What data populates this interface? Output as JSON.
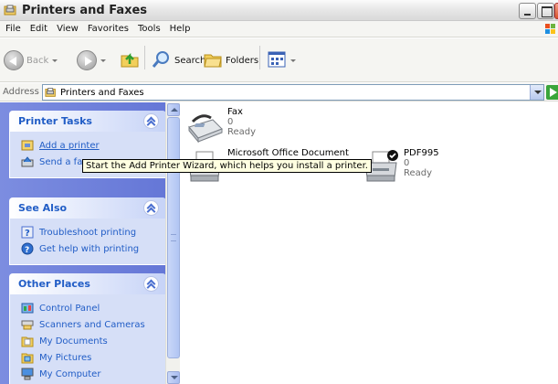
{
  "window": {
    "title": "Printers and Faxes",
    "icon": "printers-folder-icon"
  },
  "menu": [
    "File",
    "Edit",
    "View",
    "Favorites",
    "Tools",
    "Help"
  ],
  "toolbar": {
    "back_label": "Back",
    "search_label": "Search",
    "folders_label": "Folders"
  },
  "address": {
    "label": "Address",
    "value": "Printers and Faxes",
    "go_label": "Go"
  },
  "taskpane": {
    "printer_tasks": {
      "title": "Printer Tasks",
      "items": [
        {
          "label": "Add a printer",
          "icon": "add-printer-icon"
        },
        {
          "label": "Send a fax",
          "icon": "send-fax-icon"
        }
      ]
    },
    "see_also": {
      "title": "See Also",
      "items": [
        {
          "label": "Troubleshoot printing",
          "icon": "help-icon"
        },
        {
          "label": "Get help with printing",
          "icon": "help-globe-icon"
        }
      ]
    },
    "other_places": {
      "title": "Other Places",
      "items": [
        {
          "label": "Control Panel",
          "icon": "control-panel-icon"
        },
        {
          "label": "Scanners and Cameras",
          "icon": "scanner-icon"
        },
        {
          "label": "My Documents",
          "icon": "documents-folder-icon"
        },
        {
          "label": "My Pictures",
          "icon": "pictures-folder-icon"
        },
        {
          "label": "My Computer",
          "icon": "computer-icon"
        }
      ]
    }
  },
  "printers": [
    {
      "name": "Fax",
      "count": "0",
      "status": "Ready",
      "icon": "fax-icon"
    },
    {
      "name": "Microsoft Office Document",
      "count": "0",
      "status": "",
      "icon": "printer-icon"
    },
    {
      "name": "PDF995",
      "count": "0",
      "status": "Ready",
      "icon": "default-printer-icon"
    }
  ],
  "tooltip": "Start the Add Printer Wizard, which helps you install a printer.",
  "colors": {
    "taskpane_bg": "#6375d6",
    "section_title": "#215dc6",
    "link": "#215dc6"
  }
}
